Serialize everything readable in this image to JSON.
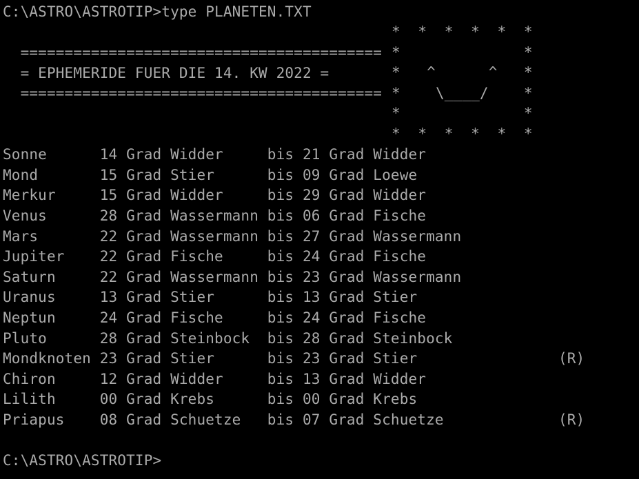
{
  "terminal": {
    "background_color": "#000000",
    "text_color": "#aaaaaa",
    "command_line": "C:\\ASTRO\\ASTROTIP>type PLANETEN.TXT",
    "trailing_prompt": "C:\\ASTRO\\ASTROTIP>"
  },
  "header": {
    "rule_top": "  =========================================",
    "title_line": "  = EPHEMERIDE FUER DIE 14. KW 2022 =",
    "title_text": "EPHEMERIDE FUER DIE 14. KW 2022",
    "rule_bottom": "  =========================================",
    "rule_char": "=",
    "rule_length": 41,
    "calendar_week": "14. KW",
    "year": "2022"
  },
  "ascii_art": {
    "name": "smiley-face-box",
    "lines": [
      "*  *  *  *  *  *",
      "*              *",
      "*   ^      ^   *",
      "*    \\____/    *",
      "*              *",
      "*  *  *  *  *  *"
    ]
  },
  "table": {
    "columns": [
      "body",
      "degree_from",
      "unit_from",
      "sign_from",
      "connector",
      "degree_to",
      "unit_to",
      "sign_to",
      "retrograde"
    ],
    "connector_word": "bis",
    "unit_word": "Grad",
    "retrograde_marker": "(R)",
    "rows": [
      {
        "body": "Sonne",
        "degree_from": "14",
        "sign_from": "Widder",
        "degree_to": "21",
        "sign_to": "Widder",
        "retrograde": ""
      },
      {
        "body": "Mond",
        "degree_from": "15",
        "sign_from": "Stier",
        "degree_to": "09",
        "sign_to": "Loewe",
        "retrograde": ""
      },
      {
        "body": "Merkur",
        "degree_from": "15",
        "sign_from": "Widder",
        "degree_to": "29",
        "sign_to": "Widder",
        "retrograde": ""
      },
      {
        "body": "Venus",
        "degree_from": "28",
        "sign_from": "Wassermann",
        "degree_to": "06",
        "sign_to": "Fische",
        "retrograde": ""
      },
      {
        "body": "Mars",
        "degree_from": "22",
        "sign_from": "Wassermann",
        "degree_to": "27",
        "sign_to": "Wassermann",
        "retrograde": ""
      },
      {
        "body": "Jupiter",
        "degree_from": "22",
        "sign_from": "Fische",
        "degree_to": "24",
        "sign_to": "Fische",
        "retrograde": ""
      },
      {
        "body": "Saturn",
        "degree_from": "22",
        "sign_from": "Wassermann",
        "degree_to": "23",
        "sign_to": "Wassermann",
        "retrograde": ""
      },
      {
        "body": "Uranus",
        "degree_from": "13",
        "sign_from": "Stier",
        "degree_to": "13",
        "sign_to": "Stier",
        "retrograde": ""
      },
      {
        "body": "Neptun",
        "degree_from": "24",
        "sign_from": "Fische",
        "degree_to": "24",
        "sign_to": "Fische",
        "retrograde": ""
      },
      {
        "body": "Pluto",
        "degree_from": "28",
        "sign_from": "Steinbock",
        "degree_to": "28",
        "sign_to": "Steinbock",
        "retrograde": ""
      },
      {
        "body": "Mondknoten",
        "degree_from": "23",
        "sign_from": "Stier",
        "degree_to": "23",
        "sign_to": "Stier",
        "retrograde": "(R)"
      },
      {
        "body": "Chiron",
        "degree_from": "12",
        "sign_from": "Widder",
        "degree_to": "13",
        "sign_to": "Widder",
        "retrograde": ""
      },
      {
        "body": "Lilith",
        "degree_from": "00",
        "sign_from": "Krebs",
        "degree_to": "00",
        "sign_to": "Krebs",
        "retrograde": ""
      },
      {
        "body": "Priapus",
        "degree_from": "08",
        "sign_from": "Schuetze",
        "degree_to": "07",
        "sign_to": "Schuetze",
        "retrograde": "(R)"
      }
    ]
  }
}
